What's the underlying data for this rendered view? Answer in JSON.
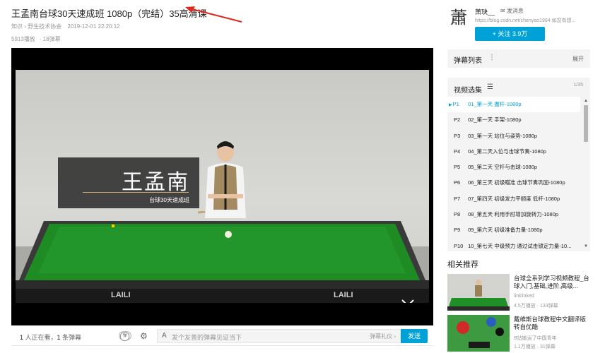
{
  "video": {
    "title": "王孟南台球30天速成班 1080p（完结）35高清课",
    "category": "知识 › 野生技术协会",
    "date": "2019-12-01 22:20:12",
    "plays": "5913播放",
    "danmaku_count": "· 18弹幕"
  },
  "overlay": {
    "name": "王孟南",
    "subtitle": "台球30天速成班",
    "table_brand": "LAILI"
  },
  "controls": {
    "viewers_num": "1",
    "viewers_text": " 人正在看，",
    "danmaku_num": "1",
    "danmaku_text": " 条弹幕",
    "input_placeholder": "发个友善的弹幕见证当下",
    "etiquette": "弹幕礼仪 ›",
    "send": "发送"
  },
  "uploader": {
    "avatar_char": "蕭",
    "name": "萧玦__",
    "message": "发消息",
    "desc": "https://blog.csdn.net/chenyao1994 如您有想...",
    "follow": "+  关注 3.9万"
  },
  "danmaku_list": {
    "title": "弹幕列表",
    "expand": "展开"
  },
  "playlist": {
    "title": "视频选集",
    "count": "1/35",
    "items": [
      {
        "p": "P1",
        "title": "01_第一天 握杆-1080p"
      },
      {
        "p": "P2",
        "title": "02_第一天 手架-1080p"
      },
      {
        "p": "P3",
        "title": "03_第一天 站位与姿势-1080p"
      },
      {
        "p": "P4",
        "title": "04_第二天入位与击球节奏-1080p"
      },
      {
        "p": "P5",
        "title": "05_第二天 空杆与击球-1080p"
      },
      {
        "p": "P6",
        "title": "06_第三天 初级瞄准 击球节奏巩固-1080p"
      },
      {
        "p": "P7",
        "title": "07_第四天 初级发力平顺度 低杆-1080p"
      },
      {
        "p": "P8",
        "title": "08_第五天 利用手肘增加旋转力-1080p"
      },
      {
        "p": "P9",
        "title": "09_第六天 初级准备力量-1080p"
      },
      {
        "p": "P10",
        "title": "10_第七天 中级预力 通过试击锁定力量-10..."
      }
    ]
  },
  "related": {
    "title": "相关推荐",
    "items": [
      {
        "title": "台球全系列学习视频教程_台球入门,基础,进阶,高级...",
        "uploader": "linklinked",
        "stats": "4.5万播放 · 133弹幕"
      },
      {
        "title": "戴维斯台球教程中文翻译版 转自优酷",
        "uploader": "B站搬运了中国青年",
        "stats": "1.1万播放 · 31弹幕"
      }
    ]
  },
  "colors": {
    "accent": "#00a1d6",
    "table_green": "#1d8a1d"
  }
}
